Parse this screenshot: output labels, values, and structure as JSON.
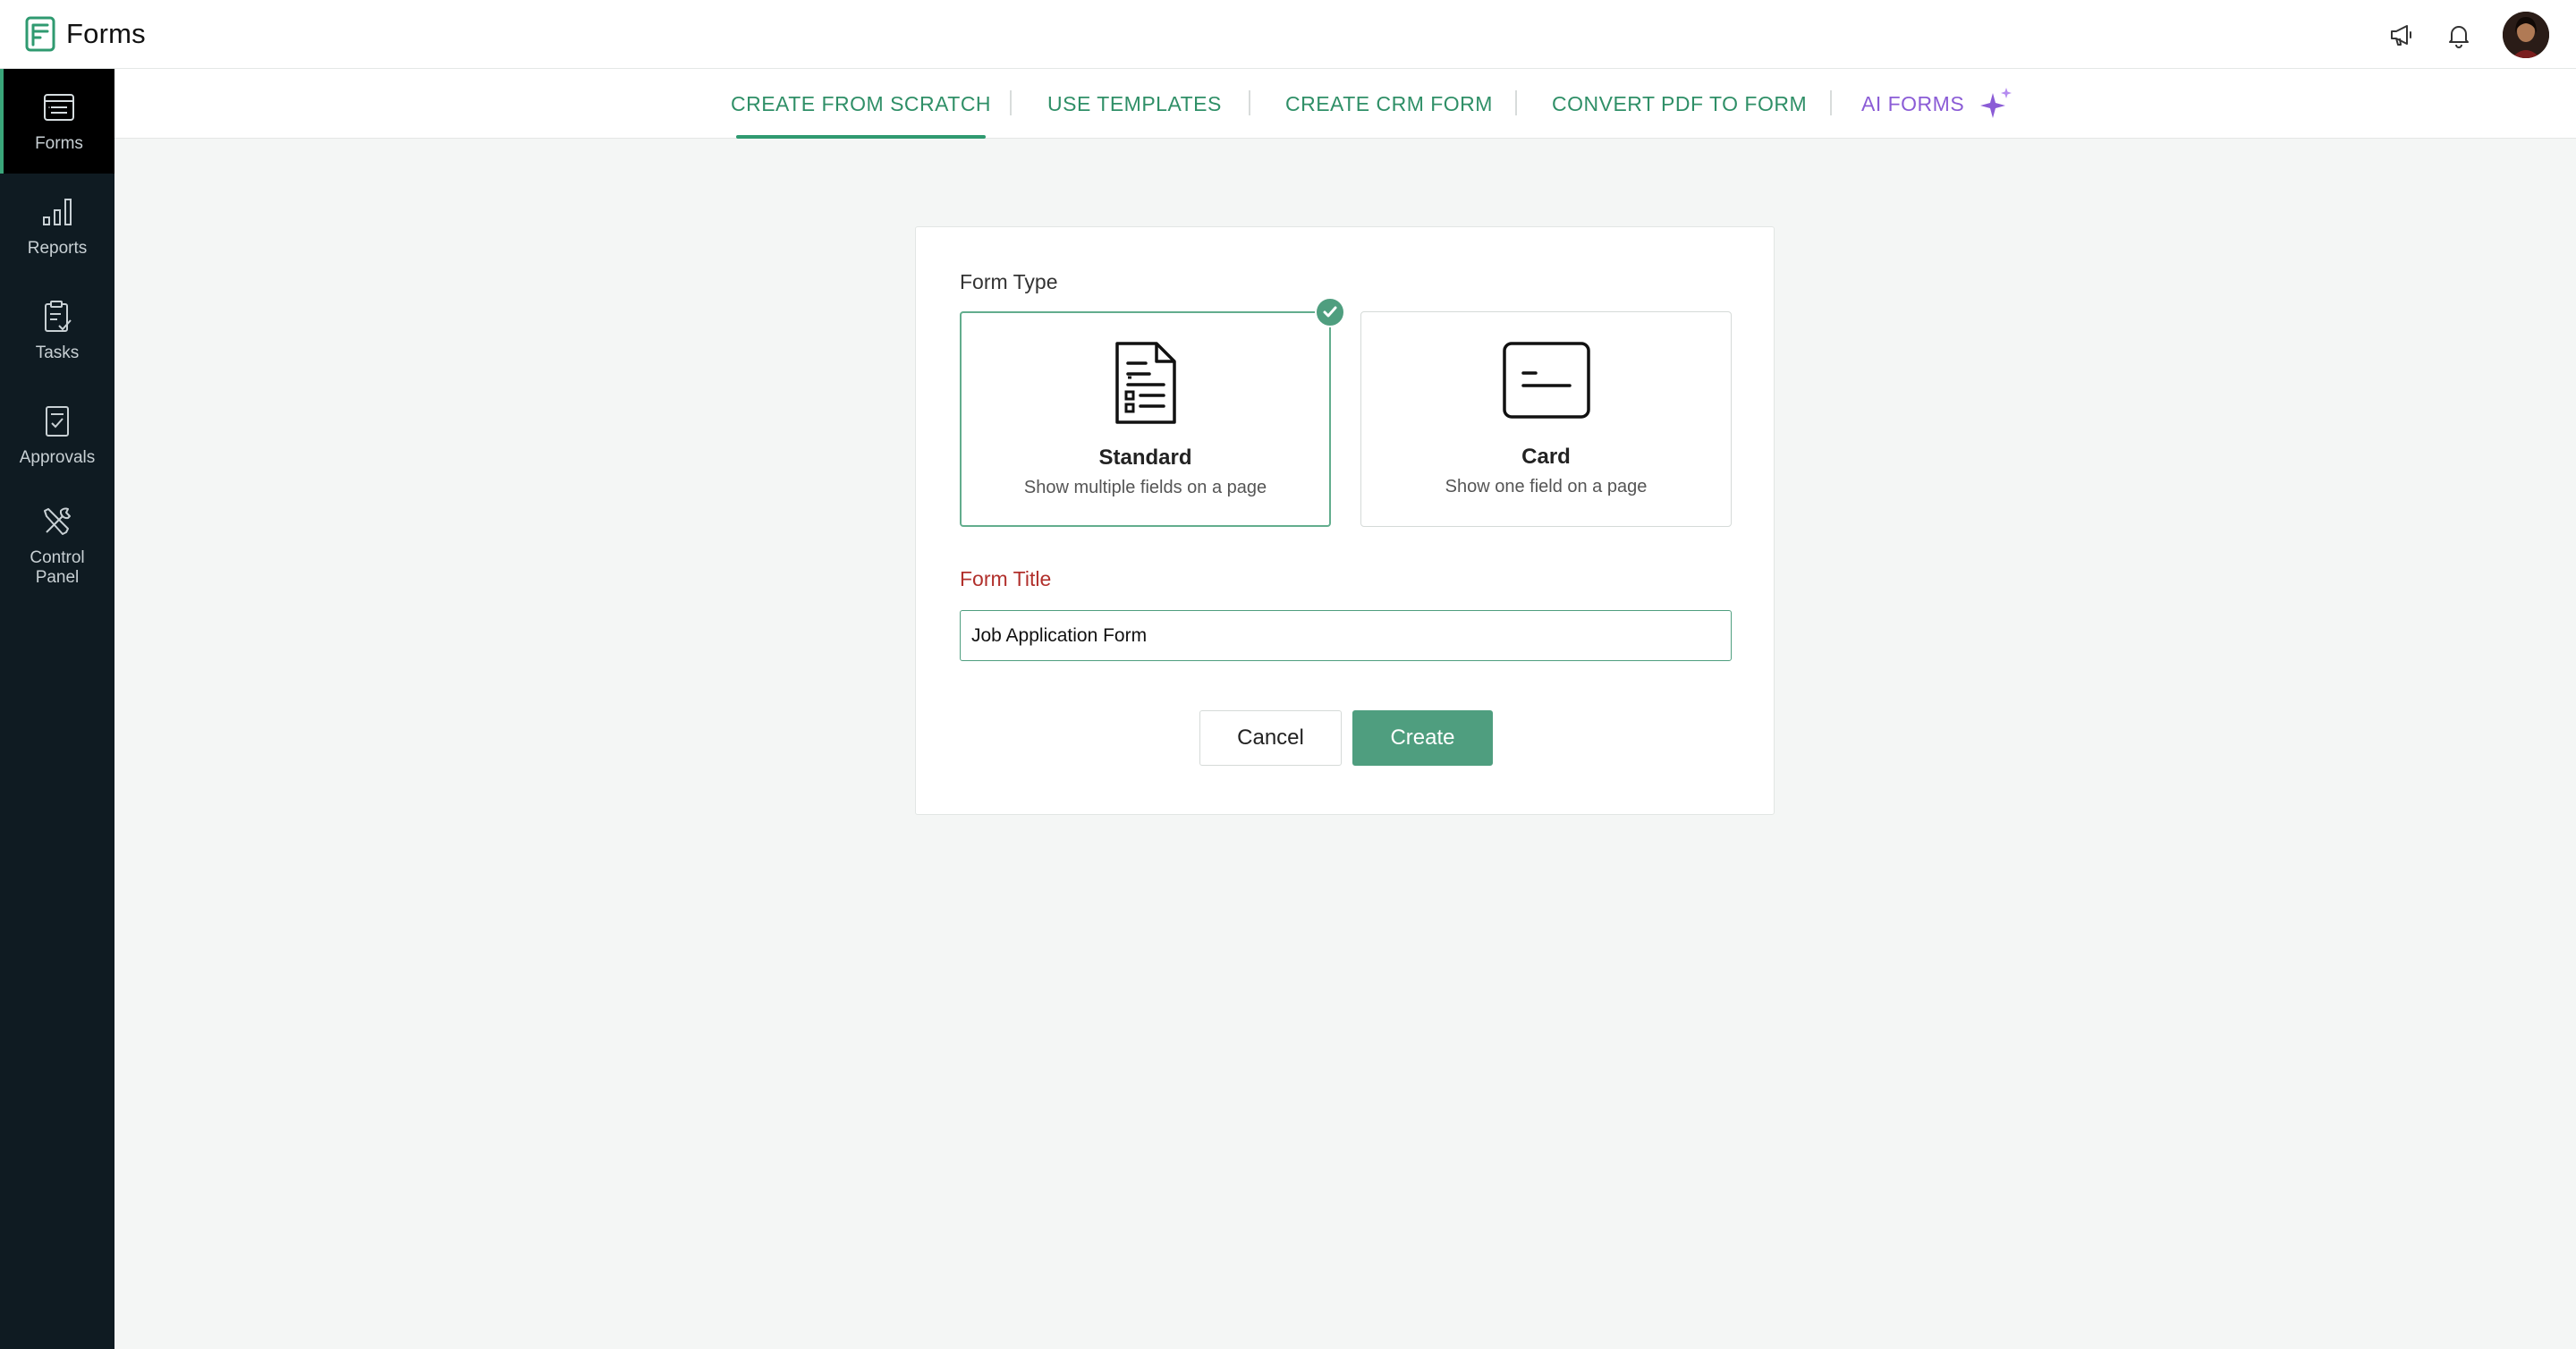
{
  "app": {
    "name": "Forms"
  },
  "header": {
    "icons": [
      "announcement-icon",
      "notification-bell-icon",
      "user-avatar"
    ]
  },
  "sidebar": {
    "items": [
      {
        "label": "Forms",
        "icon": "forms-icon",
        "active": true
      },
      {
        "label": "Reports",
        "icon": "bar-chart-icon",
        "active": false
      },
      {
        "label": "Tasks",
        "icon": "clipboard-check-icon",
        "active": false
      },
      {
        "label": "Approvals",
        "icon": "document-check-icon",
        "active": false
      },
      {
        "label": "Control Panel",
        "icon": "tools-icon",
        "active": false
      }
    ]
  },
  "tabs": [
    {
      "label": "CREATE FROM SCRATCH",
      "active": true
    },
    {
      "label": "USE TEMPLATES",
      "active": false
    },
    {
      "label": "CREATE CRM FORM",
      "active": false
    },
    {
      "label": "CONVERT PDF TO FORM",
      "active": false
    },
    {
      "label": "AI FORMS",
      "active": false,
      "icon": "sparkle-icon"
    }
  ],
  "create_form": {
    "form_type_label": "Form Type",
    "types": [
      {
        "title": "Standard",
        "subtitle": "Show multiple fields on a page",
        "selected": true
      },
      {
        "title": "Card",
        "subtitle": "Show one field on a page",
        "selected": false
      }
    ],
    "form_title_label": "Form Title",
    "form_title_value": "Job Application Form",
    "cancel_label": "Cancel",
    "create_label": "Create"
  },
  "colors": {
    "accent": "#4f9e7f",
    "tab_text": "#2f8f67",
    "ai_text": "#8b5cd6",
    "sidebar_bg": "#0f1b22",
    "required_label": "#b1302c"
  }
}
